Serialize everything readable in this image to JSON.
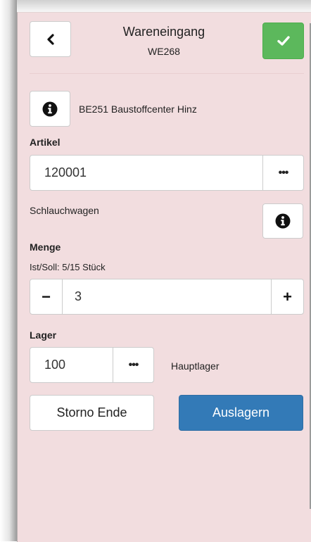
{
  "header": {
    "title": "Wareneingang",
    "subtitle": "WE268"
  },
  "supplier": {
    "text": "BE251 Baustoffcenter Hinz"
  },
  "article": {
    "label": "Artikel",
    "value": "120001",
    "lookup_label": "•••",
    "description": "Schlauchwagen"
  },
  "quantity": {
    "label": "Menge",
    "status": "Ist/Soll: 5/15 Stück",
    "value": "3",
    "minus_label": "−",
    "plus_label": "+"
  },
  "storage": {
    "label": "Lager",
    "value": "100",
    "lookup_label": "•••",
    "name": "Hauptlager"
  },
  "actions": {
    "cancel_label": "Storno Ende",
    "primary_label": "Auslagern"
  },
  "colors": {
    "background": "#f2dddf",
    "confirm": "#5cb85c",
    "primary": "#337ab7"
  },
  "icons": {
    "back": "chevron-left-icon",
    "confirm": "check-icon",
    "info": "info-circle-icon"
  }
}
